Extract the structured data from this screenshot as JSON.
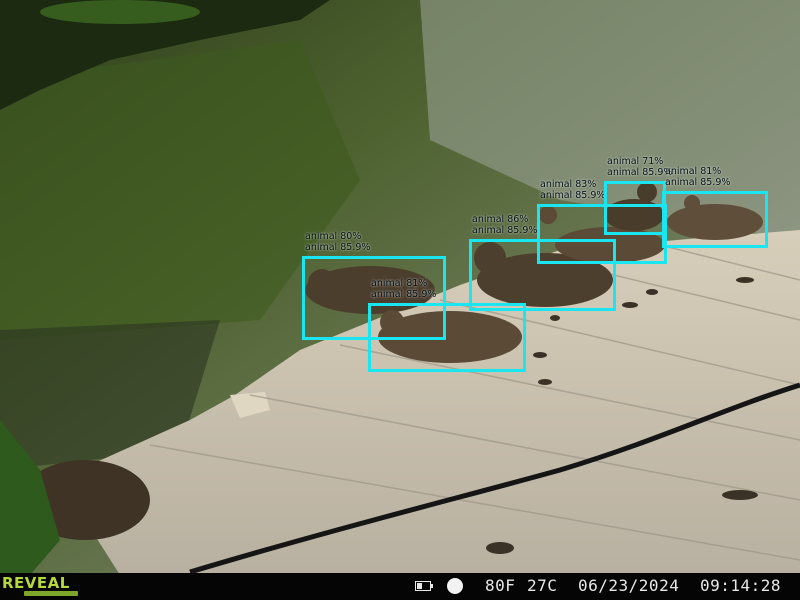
{
  "detections": [
    {
      "line1": "animal 80%",
      "line2": "animal 85.9%"
    },
    {
      "line1": "animal 81%",
      "line2": "animal 85.9%"
    },
    {
      "line1": "animal 86%",
      "line2": "animal 85.9%"
    },
    {
      "line1": "animal 83%",
      "line2": "animal 85.9%"
    },
    {
      "line1": "animal 71%",
      "line2": "animal 85.9%"
    },
    {
      "line1": "animal 81%",
      "line2": "animal 85.9%"
    }
  ],
  "footer": {
    "brand": "REVEAL",
    "temp_f": "80F",
    "temp_c": "27C",
    "date": "06/23/2024",
    "time": "09:14:28"
  },
  "colors": {
    "box": "#19e6f0",
    "water": "#4a5a2c",
    "dock": "#cfc6b2",
    "logo": "#b5d83a"
  }
}
